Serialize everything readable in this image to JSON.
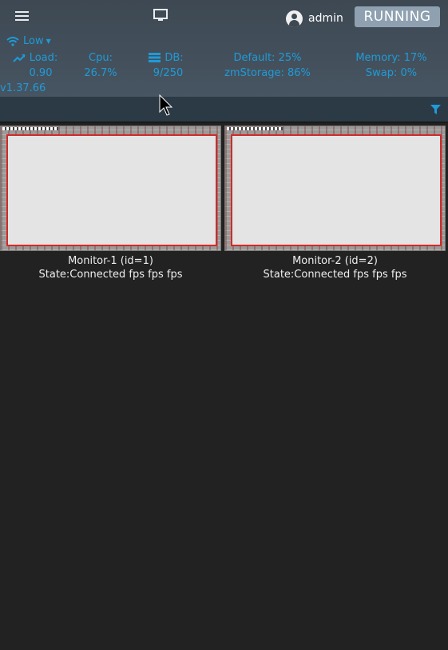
{
  "header": {
    "user": "admin",
    "state_button": "RUNNING"
  },
  "bandwidth": {
    "label": "Low"
  },
  "stats": {
    "load": {
      "label": "Load:",
      "value": "0.90"
    },
    "cpu": {
      "label": "Cpu:",
      "value": "26.7%"
    },
    "db": {
      "label": "DB:",
      "value": "9/250"
    },
    "default": {
      "label": "Default: 25%"
    },
    "zmstorage": {
      "label": "zmStorage: 86%"
    },
    "memory": {
      "label": "Memory: 17%"
    },
    "swap": {
      "label": "Swap: 0%"
    }
  },
  "version": "v1.37.66",
  "monitors": [
    {
      "title": "Monitor-1 (id=1)",
      "state": "State:Connected fps fps fps"
    },
    {
      "title": "Monitor-2 (id=2)",
      "state": "State:Connected fps fps fps"
    }
  ],
  "colors": {
    "accent": "#1f9bd8",
    "background": "#222222",
    "navbar": "#3d4852",
    "running_button": "#8fa1b1",
    "overlay_border": "#d12a2a"
  },
  "icons": [
    "menu-icon",
    "monitor-icon",
    "user-icon",
    "wifi-icon",
    "trend-up-icon",
    "database-icon",
    "filter-icon",
    "mouse-cursor-icon"
  ]
}
